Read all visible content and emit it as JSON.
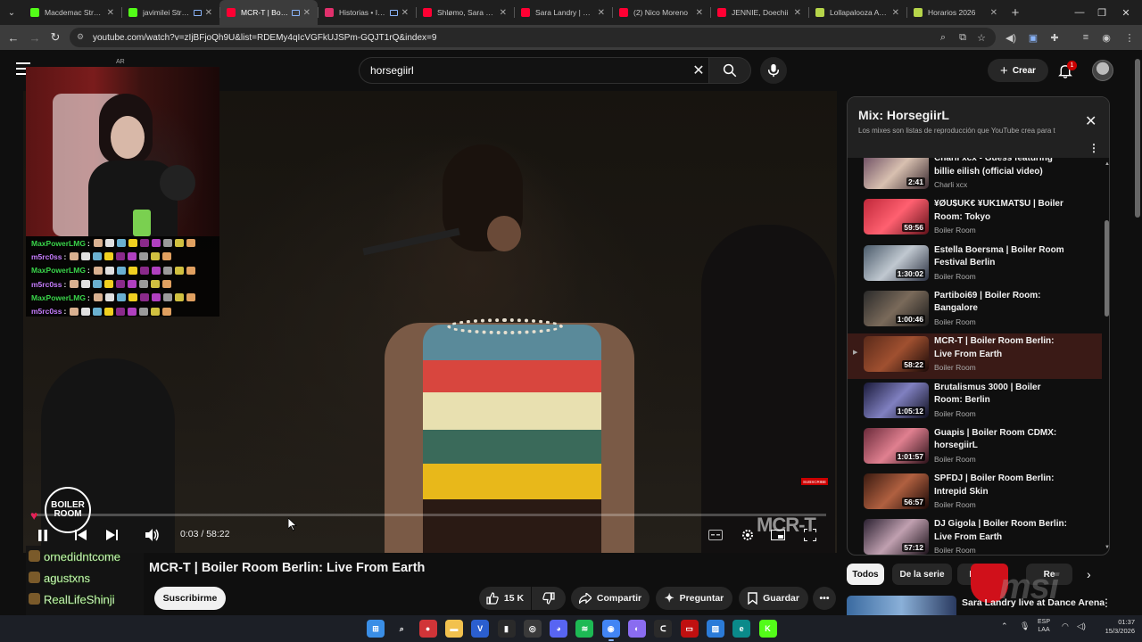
{
  "browser": {
    "tabs": [
      {
        "title": "Macdemac Stream",
        "color": "#53fc18",
        "active": false,
        "media": false
      },
      {
        "title": "javimilei Stream",
        "color": "#53fc18",
        "active": false,
        "media": true
      },
      {
        "title": "MCR-T | Boiler",
        "color": "#ff0033",
        "active": true,
        "media": true
      },
      {
        "title": "Historias • Instagram",
        "color": "#e1306c",
        "active": false,
        "media": true
      },
      {
        "title": "Shlømo, Sara Landry",
        "color": "#ff0033",
        "active": false,
        "media": false
      },
      {
        "title": "Sara Landry | Boiler",
        "color": "#ff0033",
        "active": false,
        "media": false
      },
      {
        "title": "(2) Nico Moreno",
        "color": "#ff0033",
        "active": false,
        "media": false
      },
      {
        "title": "JENNIE, Doechii",
        "color": "#ff0033",
        "active": false,
        "media": false
      },
      {
        "title": "Lollapalooza Argentina",
        "color": "#b6d54a",
        "active": false,
        "media": false
      },
      {
        "title": "Horarios 2026",
        "color": "#b6d54a",
        "active": false,
        "media": false
      }
    ],
    "url": "youtube.com/watch?v=zIjBFjoQh9U&list=RDEMy4qIcVGFkUJSPm-GQJT1rQ&index=9"
  },
  "masthead": {
    "logo_country": "AR",
    "search_value": "horsegiirl",
    "create_label": "Crear",
    "notification_count": "1"
  },
  "player": {
    "time_label": "0:03 / 58:22",
    "progress": 0.001,
    "watermark": "MCR-T",
    "logo_text_1": "BOILER",
    "logo_text_2": "ROOM",
    "subscribe_badge": "SUBSCRIBE"
  },
  "overlay": {
    "chat": [
      {
        "user": "MaxPowerLMG",
        "cls": "u2"
      },
      {
        "user": "m5rc0ss",
        "cls": "u1"
      },
      {
        "user": "MaxPowerLMG",
        "cls": "u2"
      },
      {
        "user": "m5rc0ss",
        "cls": "u1"
      },
      {
        "user": "MaxPowerLMG",
        "cls": "u2"
      },
      {
        "user": "m5rc0ss",
        "cls": "u1"
      }
    ],
    "donors": [
      "ornedidntcome",
      "agustxns",
      "RealLifeShinji"
    ]
  },
  "video": {
    "title": "MCR-T | Boiler Room Berlin: Live From Earth",
    "subscribe_label": "Suscribirme",
    "likes": "15 K",
    "share_label": "Compartir",
    "ask_label": "Preguntar",
    "save_label": "Guardar"
  },
  "mix": {
    "title": "Mix: HorsegiirL",
    "description": "Los mixes son listas de reproducción que YouTube crea para t",
    "items": [
      {
        "title": "Charli xcx - Guess featuring billie eilish (official video)",
        "channel": "Charli xcx",
        "duration": "2:41",
        "current": false,
        "thumb": "linear-gradient(135deg,#6a4a60,#d8c0b0 50%,#3a2a30)"
      },
      {
        "title": "¥ØU$UK€ ¥UK1MAT$U | Boiler Room: Tokyo",
        "channel": "Boiler Room",
        "duration": "59:56",
        "current": false,
        "thumb": "linear-gradient(135deg,#c0283a,#ff6070 50%,#601018)"
      },
      {
        "title": "Estella Boersma | Boiler Room Festival Berlin",
        "channel": "Boiler Room",
        "duration": "1:30:02",
        "current": false,
        "thumb": "linear-gradient(135deg,#4a5a6a,#c0c8d0 50%,#2a3040)"
      },
      {
        "title": "Partiboi69 | Boiler Room: Bangalore",
        "channel": "Boiler Room",
        "duration": "1:00:46",
        "current": false,
        "thumb": "linear-gradient(135deg,#2a2a2a,#7a6a5a 50%,#1a1a1a)"
      },
      {
        "title": "MCR-T | Boiler Room Berlin: Live From Earth",
        "channel": "Boiler Room",
        "duration": "58:22",
        "current": true,
        "thumb": "linear-gradient(135deg,#5a2a1a,#a05030 50%,#1a0a08)"
      },
      {
        "title": "Brutalismus 3000 | Boiler Room: Berlin",
        "channel": "Boiler Room",
        "duration": "1:05:12",
        "current": false,
        "thumb": "linear-gradient(135deg,#1a1a3a,#8080c0 50%,#101020)"
      },
      {
        "title": "Guapis | Boiler Room CDMX: horsegiirL",
        "channel": "Boiler Room",
        "duration": "1:01:57",
        "current": false,
        "thumb": "linear-gradient(135deg,#6a2a3a,#e08090 50%,#2a1018)"
      },
      {
        "title": "SPFDJ | Boiler Room Berlin: Intrepid Skin",
        "channel": "Boiler Room",
        "duration": "56:57",
        "current": false,
        "thumb": "linear-gradient(135deg,#3a1a10,#b06040 50%,#1a0806)"
      },
      {
        "title": "DJ Gigola | Boiler Room Berlin: Live From Earth",
        "channel": "Boiler Room",
        "duration": "57:12",
        "current": false,
        "thumb": "linear-gradient(135deg,#2a2030,#c0a0b0 50%,#1a1018)"
      }
    ]
  },
  "chips": [
    {
      "label": "Todos",
      "active": true
    },
    {
      "label": "De la serie",
      "active": false
    },
    {
      "label": "Bo",
      "active": false
    },
    {
      "label": "Re",
      "active": false
    }
  ],
  "next_video": {
    "title": "Sara Landry live at Dance Arena"
  },
  "overlay_brand": "msi",
  "taskbar": {
    "apps": [
      {
        "name": "windows-start",
        "color": "#3a8ee6",
        "glyph": "⊞"
      },
      {
        "name": "search",
        "color": "transparent",
        "glyph": "⌕"
      },
      {
        "name": "app-red",
        "color": "#d13438",
        "glyph": "●"
      },
      {
        "name": "file-explorer",
        "color": "#f2c14e",
        "glyph": "▬"
      },
      {
        "name": "app-v",
        "color": "#2b5fcf",
        "glyph": "V"
      },
      {
        "name": "app-dark",
        "color": "#2a2a2a",
        "glyph": "▮"
      },
      {
        "name": "app-circle",
        "color": "#3a3a3a",
        "glyph": "◎"
      },
      {
        "name": "discord",
        "color": "#5865f2",
        "glyph": "◕"
      },
      {
        "name": "spotify",
        "color": "#1db954",
        "glyph": "≋"
      },
      {
        "name": "chrome",
        "color": "#4285f4",
        "glyph": "◉"
      },
      {
        "name": "app-web",
        "color": "#8a6cf0",
        "glyph": "◐"
      },
      {
        "name": "app-c",
        "color": "#2a2a2a",
        "glyph": "ᑕ"
      },
      {
        "name": "app-voicemeeter",
        "color": "#c01010",
        "glyph": "▭"
      },
      {
        "name": "photos",
        "color": "#2b7bd8",
        "glyph": "▨"
      },
      {
        "name": "edge",
        "color": "#0a8a8a",
        "glyph": "e"
      },
      {
        "name": "kick",
        "color": "#53fc18",
        "glyph": "K"
      }
    ],
    "lang": "ESP",
    "lang_sub": "LAA",
    "time": "01:37",
    "date": "15/3/2026"
  }
}
